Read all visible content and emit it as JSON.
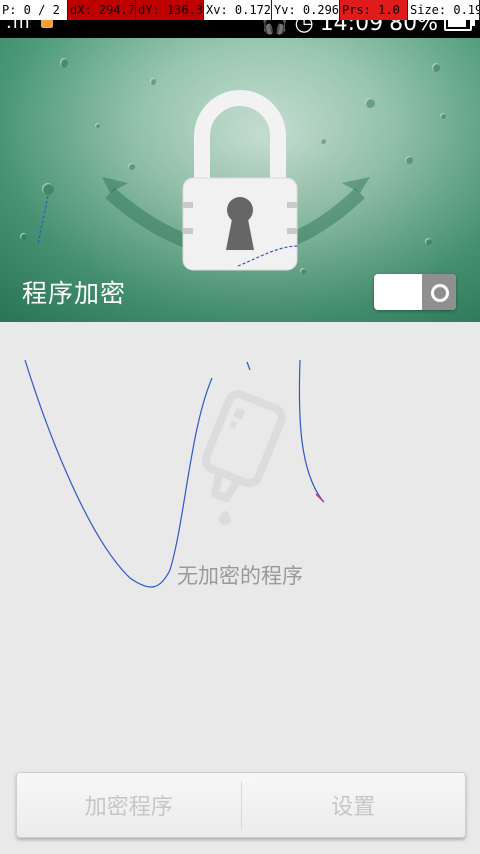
{
  "debug_overlay": {
    "p": "P: 0 / 2",
    "dx": "dX: 294.7",
    "dy": "dY: 136.3",
    "xv": "Xv: 0.172",
    "yv": "Yv: 0.296",
    "prs": "Prs: 1.0",
    "size": "Size: 0.19"
  },
  "status_bar": {
    "time": "14:09",
    "battery": "80%",
    "icons": [
      "signal-icon",
      "notification-icon",
      "headset-icon",
      "alarm-icon",
      "battery-icon"
    ]
  },
  "header": {
    "title": "程序加密",
    "accent_color": "#2f7d5c"
  },
  "empty_state": {
    "message": "无加密的程序"
  },
  "buttons": {
    "encrypt_label": "加密程序",
    "settings_label": "设置"
  }
}
